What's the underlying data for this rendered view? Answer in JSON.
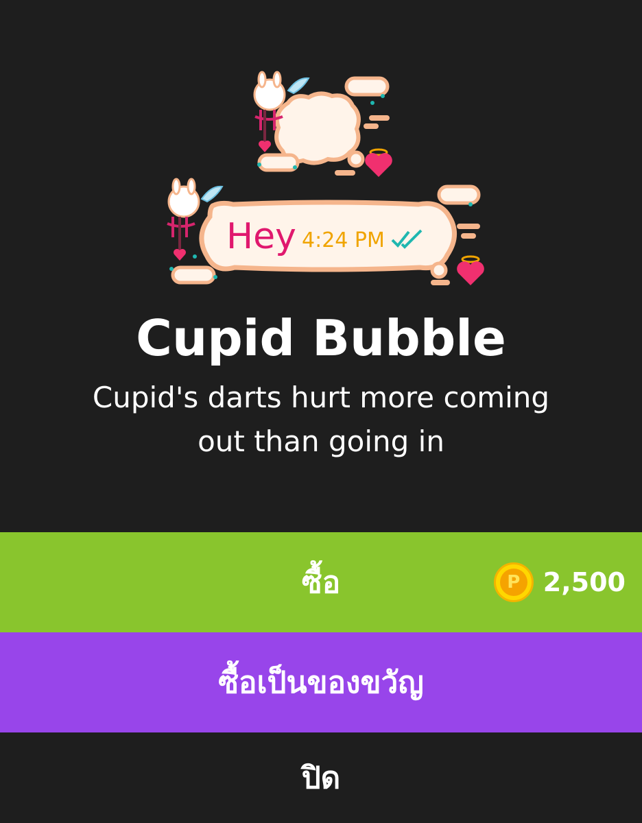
{
  "sticker": {
    "name": "Cupid Bubble",
    "description": "Cupid's darts hurt more coming out than going in",
    "preview_message": "Hey",
    "preview_time": "4:24 PM"
  },
  "actions": {
    "buy_label": "ซื้อ",
    "gift_label": "ซื้อเป็นของขวัญ",
    "close_label": "ปิด"
  },
  "price": {
    "amount": "2,500",
    "coin_letter": "P"
  },
  "colors": {
    "background": "#1e1e1e",
    "buy": "#89c52d",
    "gift": "#9845ea",
    "bubble_fill": "#fff4ea",
    "bubble_border": "#f5b58c",
    "message_text": "#e0186e",
    "time_text": "#f0a400",
    "check": "#1fb7b0"
  }
}
